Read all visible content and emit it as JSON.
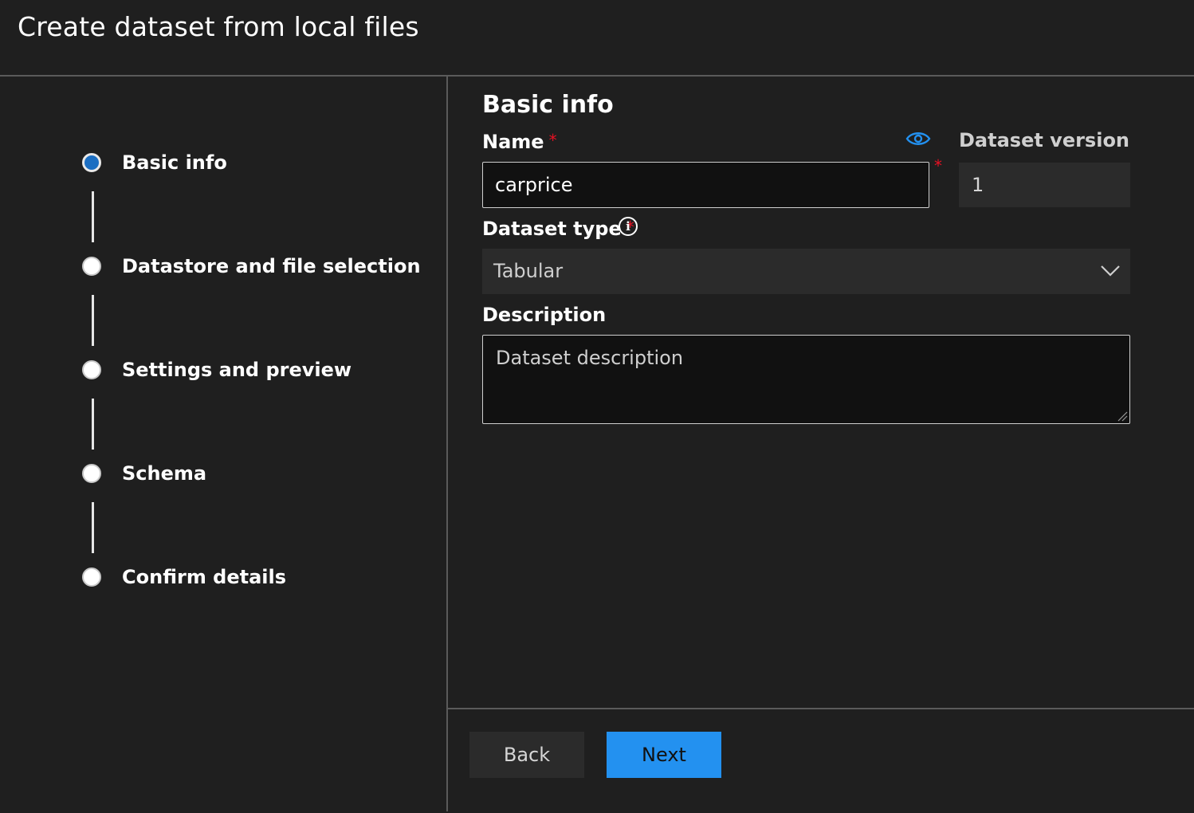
{
  "header": {
    "title": "Create dataset from local files"
  },
  "steps": [
    {
      "label": "Basic info",
      "active": true
    },
    {
      "label": "Datastore and file selection",
      "active": false
    },
    {
      "label": "Settings and preview",
      "active": false
    },
    {
      "label": "Schema",
      "active": false
    },
    {
      "label": "Confirm details",
      "active": false
    }
  ],
  "form": {
    "section_title": "Basic info",
    "name": {
      "label": "Name",
      "required_mark": "*",
      "value": "carprice"
    },
    "dataset_version": {
      "label": "Dataset version",
      "required_mark": "*",
      "value": "1"
    },
    "dataset_type": {
      "label": "Dataset type",
      "required_mark": "*",
      "info_glyph": "i",
      "value": "Tabular"
    },
    "description": {
      "label": "Description",
      "placeholder": "Dataset description"
    }
  },
  "footer": {
    "back_label": "Back",
    "next_label": "Next"
  },
  "colors": {
    "background": "#1f1f1f",
    "accent": "#2391f0",
    "active_step": "#1b6ec2",
    "required": "#e81123"
  },
  "icons": [
    "eye-icon",
    "info-icon",
    "chevron-down-icon",
    "resize-handle-icon"
  ]
}
